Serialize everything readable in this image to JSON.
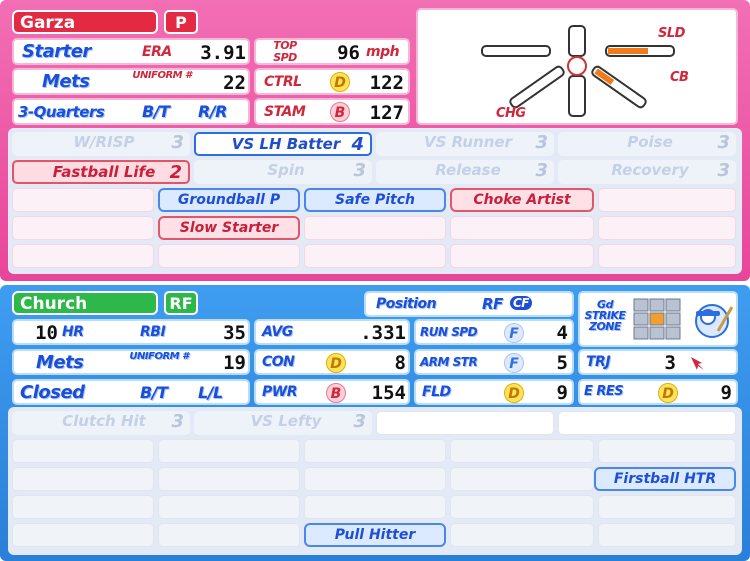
{
  "pitcher": {
    "name": "Garza",
    "position": "P",
    "role": "Starter",
    "era_label": "ERA",
    "era": "3.91",
    "top_spd_label": "TOP SPD",
    "top_spd": "96",
    "top_spd_unit": "mph",
    "team": "Mets",
    "uniform_label": "UNIFORM #",
    "uniform": "22",
    "ctrl_label": "CTRL",
    "ctrl_grade": "D",
    "ctrl": "122",
    "arm_slot": "3-Quarters",
    "bt_label": "B/T",
    "bt": "R/R",
    "stam_label": "STAM",
    "stam_grade": "B",
    "stam": "127",
    "pitches": {
      "sld": "SLD",
      "cb": "CB",
      "chg": "CHG"
    },
    "abilities": [
      {
        "label": "W/RISP",
        "level": "3",
        "state": "ghost"
      },
      {
        "label": "VS LH Batter",
        "level": "4",
        "state": "active"
      },
      {
        "label": "VS Runner",
        "level": "3",
        "state": "ghost"
      },
      {
        "label": "Poise",
        "level": "3",
        "state": "ghost"
      },
      {
        "label": "Fastball Life",
        "level": "2",
        "state": "red"
      },
      {
        "label": "Spin",
        "level": "3",
        "state": "ghost"
      },
      {
        "label": "Release",
        "level": "3",
        "state": "ghost"
      },
      {
        "label": "Recovery",
        "level": "3",
        "state": "ghost"
      }
    ],
    "skills": [
      {
        "label": "Groundball P",
        "color": "blue"
      },
      {
        "label": "Safe Pitch",
        "color": "blue"
      },
      {
        "label": "Choke Artist",
        "color": "red"
      },
      {
        "label": "Slow Starter",
        "color": "red"
      }
    ]
  },
  "batter": {
    "name": "Church",
    "position": "RF",
    "position_label": "Position",
    "positions": "RF",
    "positions_secondary": "CF",
    "hr": "10",
    "hr_label": "HR",
    "rbi_label": "RBI",
    "rbi": "35",
    "avg_label": "AVG",
    "avg": ".331",
    "runspd_label": "RUN SPD",
    "runspd_grade": "F",
    "runspd": "4",
    "gd_strike_zone": "Gd STRIKE ZONE",
    "team": "Mets",
    "uniform_label": "UNIFORM #",
    "uniform": "19",
    "con_label": "CON",
    "con_grade": "D",
    "con": "8",
    "armstr_label": "ARM STR",
    "armstr_grade": "F",
    "armstr": "5",
    "trj_label": "TRJ",
    "trj": "3",
    "stance": "Closed",
    "bt_label": "B/T",
    "bt": "L/L",
    "pwr_label": "PWR",
    "pwr_grade": "B",
    "pwr": "154",
    "fld_label": "FLD",
    "fld_grade": "D",
    "fld": "9",
    "eres_label": "E RES",
    "eres_grade": "D",
    "eres": "9",
    "abilities": [
      {
        "label": "Clutch Hit",
        "level": "3"
      },
      {
        "label": "VS Lefty",
        "level": "3"
      }
    ],
    "skills": [
      {
        "label": "Firstball HTR",
        "color": "blue"
      },
      {
        "label": "Pull Hitter",
        "color": "blue"
      }
    ]
  },
  "colors": {
    "pitcher_panel": "#e8459a",
    "batter_panel": "#2a7fd8",
    "skill_blue": "#1c4ed8",
    "skill_red": "#c8203a"
  }
}
